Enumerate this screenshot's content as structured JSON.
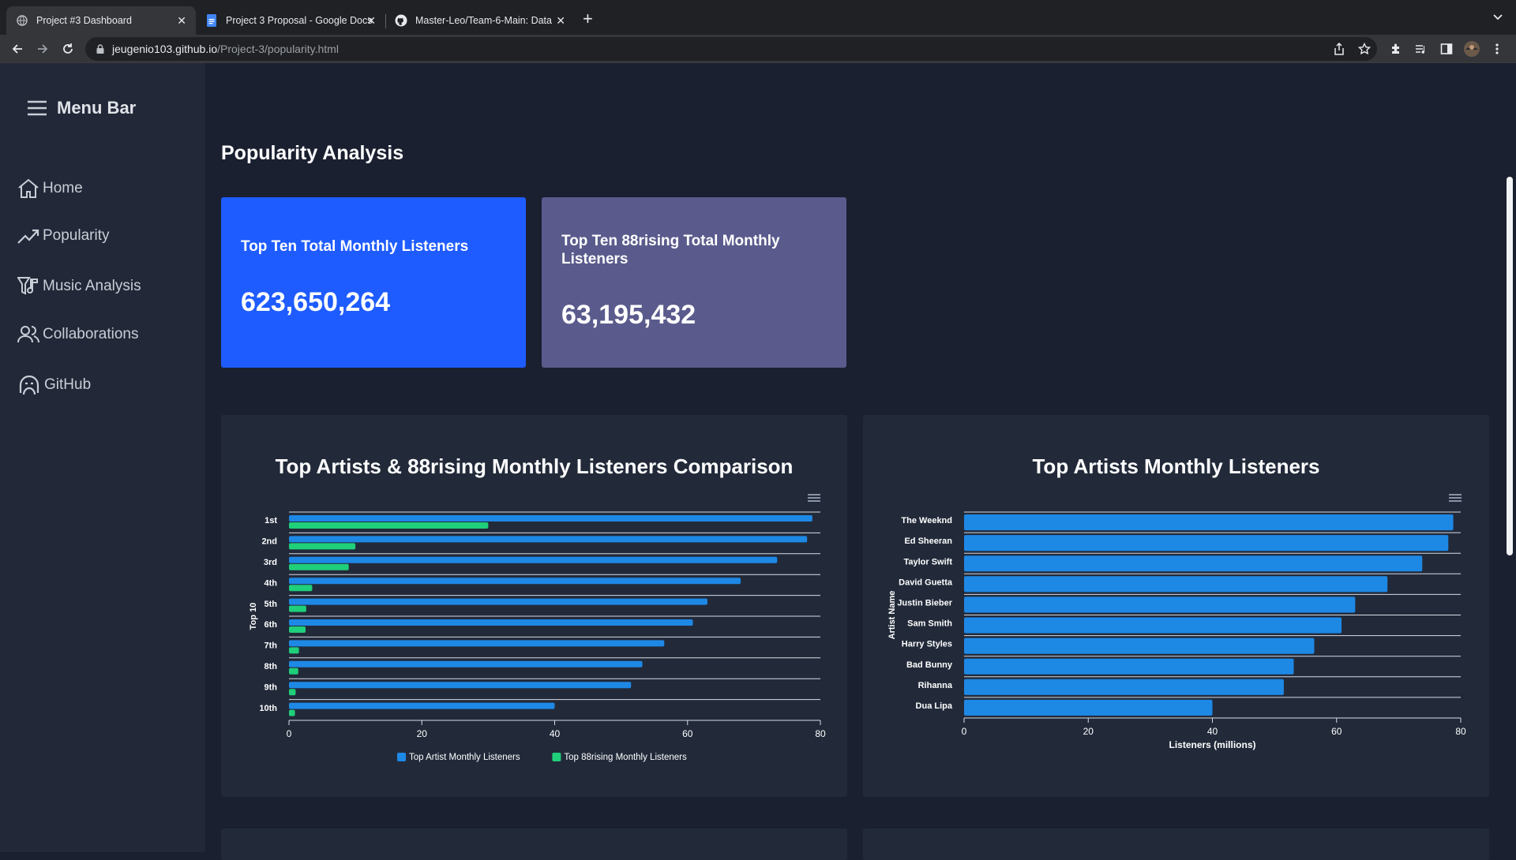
{
  "browser": {
    "tabs": [
      {
        "title": "Project #3 Dashboard",
        "icon": "globe-icon"
      },
      {
        "title": "Project 3 Proposal - Google Docs",
        "icon": "google-docs-icon"
      },
      {
        "title": "Master-Leo/Team-6-Main: Data",
        "icon": "github-icon"
      }
    ],
    "url_host": "jeugenio103.github.io",
    "url_path": "/Project-3/popularity.html"
  },
  "sidebar": {
    "title": "Menu Bar",
    "items": [
      {
        "label": "Home",
        "icon": "home-icon"
      },
      {
        "label": "Popularity",
        "icon": "trending-up-icon"
      },
      {
        "label": "Music Analysis",
        "icon": "music-filter-icon"
      },
      {
        "label": "Collaborations",
        "icon": "users-icon"
      },
      {
        "label": "GitHub",
        "icon": "github-head-icon"
      }
    ]
  },
  "main": {
    "title": "Popularity Analysis",
    "cards": [
      {
        "title": "Top Ten Total Monthly Listeners",
        "value": "623,650,264",
        "color": "#1f5cff"
      },
      {
        "title": "Top Ten 88rising Total Monthly Listeners",
        "value": "63,195,432",
        "color": "#5a5b8c"
      }
    ]
  },
  "colors": {
    "blue_series": "#1e88e5",
    "green_series": "#1fcf7a",
    "panel": "#222a3a"
  },
  "chart_data": [
    {
      "type": "bar",
      "title": "Top Artists & 88rising Monthly Listeners Comparison",
      "ylabel": "Top 10",
      "xlabel": "",
      "categories": [
        "1st",
        "2nd",
        "3rd",
        "4th",
        "5th",
        "6th",
        "7th",
        "8th",
        "9th",
        "10th"
      ],
      "xlim": [
        0,
        80
      ],
      "xticks": [
        "0",
        "20",
        "40",
        "60",
        "80"
      ],
      "series": [
        {
          "name": "Top Artist Monthly Listeners",
          "color": "#1e88e5",
          "values": [
            78.8,
            78.0,
            73.5,
            68.0,
            63.0,
            60.8,
            56.5,
            53.2,
            51.5,
            40.0
          ]
        },
        {
          "name": "Top 88rising Monthly Listeners",
          "color": "#1fcf7a",
          "values": [
            30.0,
            10.0,
            9.0,
            3.5,
            2.6,
            2.5,
            1.5,
            1.4,
            1.0,
            0.9
          ]
        }
      ],
      "legend": "bottom"
    },
    {
      "type": "bar",
      "title": "Top Artists Monthly Listeners",
      "ylabel": "Artist Name",
      "xlabel": "Listeners (millions)",
      "categories": [
        "The Weeknd",
        "Ed Sheeran",
        "Taylor Swift",
        "David Guetta",
        "Justin Bieber",
        "Sam Smith",
        "Harry Styles",
        "Bad Bunny",
        "Rihanna",
        "Dua Lipa"
      ],
      "xlim": [
        0,
        80
      ],
      "xticks": [
        "0",
        "20",
        "40",
        "60",
        "80"
      ],
      "series": [
        {
          "name": "",
          "color": "#1e88e5",
          "values": [
            78.8,
            78.0,
            73.8,
            68.2,
            63.0,
            60.8,
            56.4,
            53.1,
            51.5,
            40.0
          ]
        }
      ],
      "legend": "none"
    }
  ]
}
